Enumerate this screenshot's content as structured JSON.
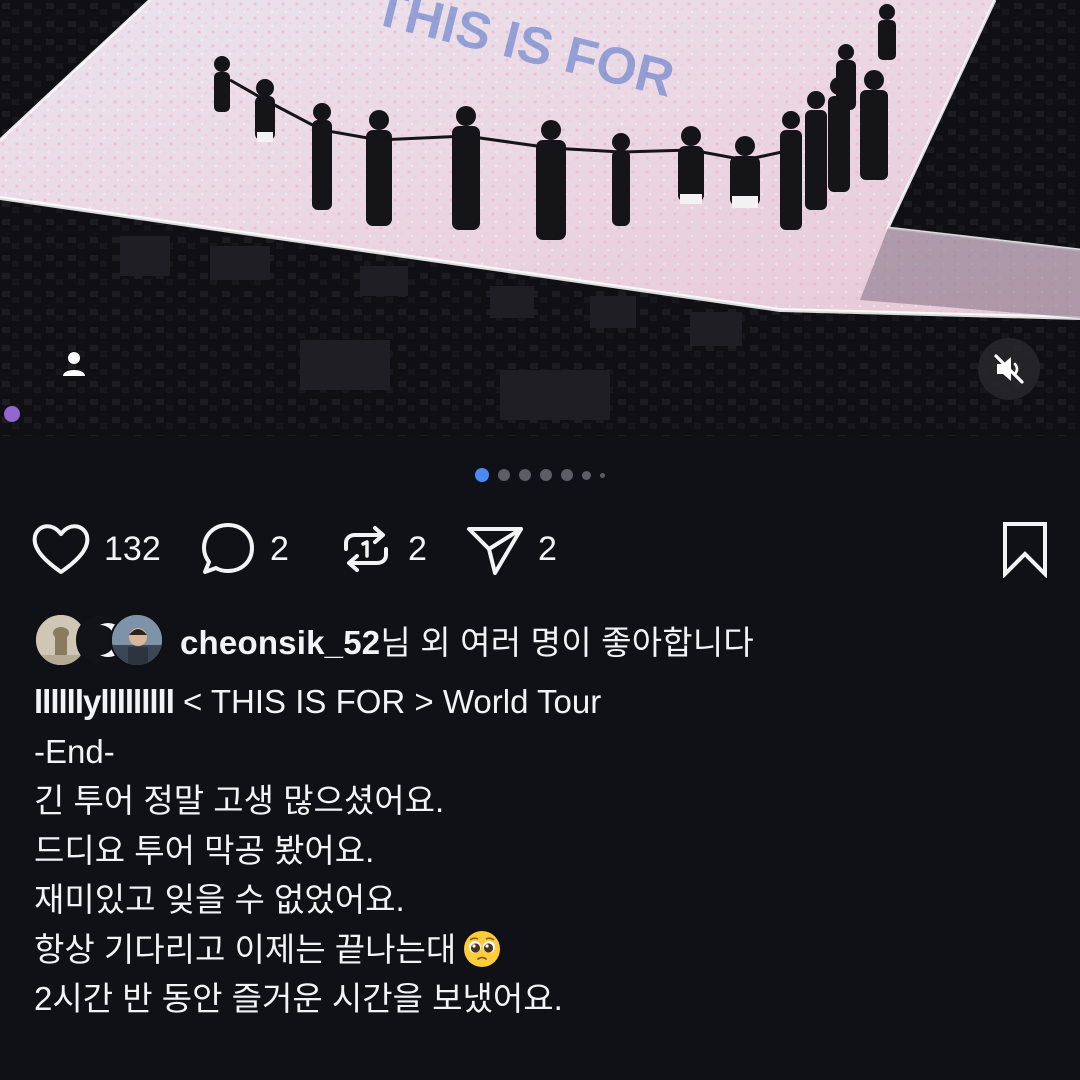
{
  "photo": {
    "stage_banner_text": "THIS IS FOR",
    "tag_icon": "person-icon",
    "mute_icon": "speaker-muted-icon"
  },
  "carousel": {
    "total_dots": 7,
    "active_index": 0
  },
  "actions": {
    "like_count": "132",
    "comment_count": "2",
    "repost_count": "2",
    "share_count": "2"
  },
  "liked_by": {
    "username": "cheonsik_52",
    "suffix": "님 외 여러 명이 좋아합니다"
  },
  "caption": {
    "handle": "llllllylllllllll",
    "line1_rest": " < THIS IS FOR > World Tour",
    "line2": "-End-",
    "line3": "긴 투어 정말 고생 많으셨어요.",
    "line4": "드디요 투어 막공 봤어요.",
    "line5": "재미있고 잊을 수 없었어요.",
    "line6": "항상 기다리고 이제는 끝나는대",
    "line6_emoji": "pleading-face-emoji",
    "line7": "2시간 반 동안 즐거운 시간을 보냈어요."
  },
  "colors": {
    "background": "#0f1116",
    "text": "#f2f3f5",
    "active_dot": "#4a8af4",
    "inactive_dot": "#5c5e66"
  }
}
